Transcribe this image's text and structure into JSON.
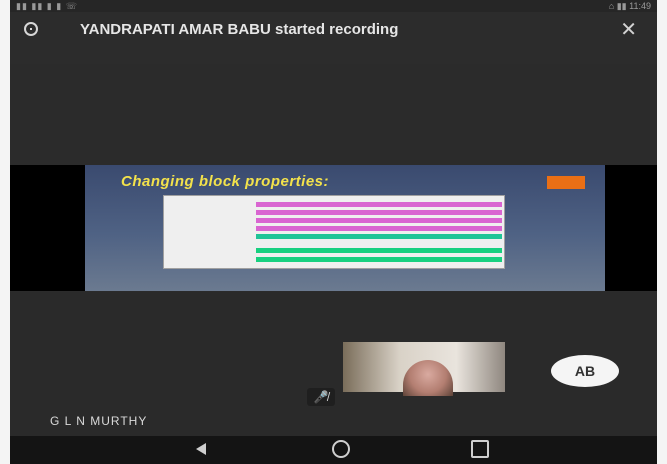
{
  "status_bar": {
    "left": "▮▮ ▮▮ ▮ ▮ ☏",
    "right": "⌂ ▮▮ 11:49"
  },
  "banner": {
    "message": "YANDRAPATI AMAR BABU started recording"
  },
  "presentation": {
    "slide_title": "Changing block properties:"
  },
  "participants": {
    "speaker_name": "G L N MURTHY",
    "avatar_initials": "AB"
  },
  "icons": {
    "info": "info-icon",
    "close": "close-icon",
    "mic_off": "mic-off-icon",
    "back": "back-icon",
    "home": "home-icon",
    "recents": "recents-icon"
  }
}
